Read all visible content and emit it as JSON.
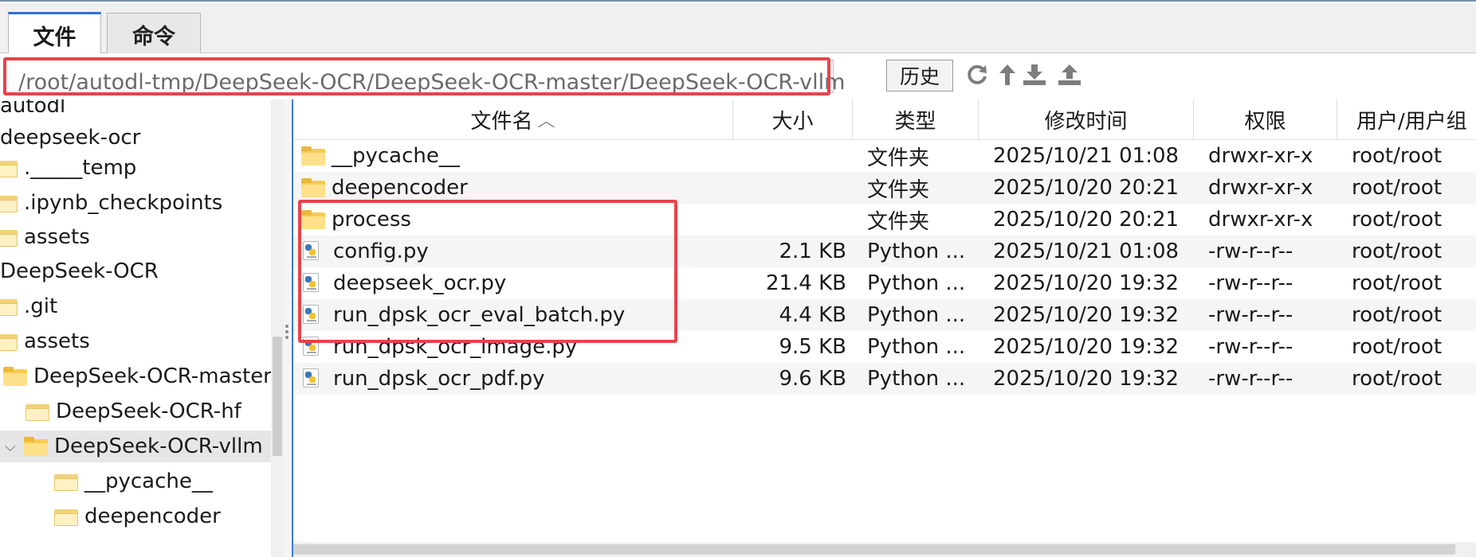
{
  "tabs": [
    {
      "label": "文件",
      "active": true
    },
    {
      "label": "命令",
      "active": false
    }
  ],
  "path_bar": {
    "value": "/root/autodl-tmp/DeepSeek-OCR/DeepSeek-OCR-master/DeepSeek-OCR-vllm",
    "history_label": "历史"
  },
  "toolbar_icons": [
    "refresh-icon",
    "up-directory-icon",
    "download-icon",
    "upload-icon"
  ],
  "tree": [
    {
      "label": "autodl",
      "indent": 0,
      "icon": false
    },
    {
      "label": "deepseek-ocr",
      "indent": 0,
      "icon": false
    },
    {
      "label": "._____temp",
      "indent": 1,
      "icon": true
    },
    {
      "label": ".ipynb_checkpoints",
      "indent": 1,
      "icon": true
    },
    {
      "label": "assets",
      "indent": 1,
      "icon": true
    },
    {
      "label": "DeepSeek-OCR",
      "indent": 0,
      "icon": false
    },
    {
      "label": ".git",
      "indent": 1,
      "icon": true
    },
    {
      "label": "assets",
      "indent": 1,
      "icon": true
    },
    {
      "label": "DeepSeek-OCR-master",
      "indent": 1,
      "icon": true
    },
    {
      "label": "DeepSeek-OCR-hf",
      "indent": 2,
      "icon": true
    },
    {
      "label": "DeepSeek-OCR-vllm",
      "indent": 2,
      "icon": true,
      "selected": true,
      "expanded": true
    },
    {
      "label": "__pycache__",
      "indent": 3,
      "icon": true
    },
    {
      "label": "deepencoder",
      "indent": 3,
      "icon": true
    }
  ],
  "columns": [
    "文件名",
    "大小",
    "类型",
    "修改时间",
    "权限",
    "用户/用户组"
  ],
  "files": [
    {
      "name": "__pycache__",
      "kind": "folder",
      "size": "",
      "type": "文件夹",
      "modified": "2025/10/21 01:08",
      "perm": "drwxr-xr-x",
      "owner": "root/root"
    },
    {
      "name": "deepencoder",
      "kind": "folder",
      "size": "",
      "type": "文件夹",
      "modified": "2025/10/20 20:21",
      "perm": "drwxr-xr-x",
      "owner": "root/root"
    },
    {
      "name": "process",
      "kind": "folder",
      "size": "",
      "type": "文件夹",
      "modified": "2025/10/20 20:21",
      "perm": "drwxr-xr-x",
      "owner": "root/root"
    },
    {
      "name": "config.py",
      "kind": "python",
      "size": "2.1 KB",
      "type": "Python ...",
      "modified": "2025/10/21 01:08",
      "perm": "-rw-r--r--",
      "owner": "root/root"
    },
    {
      "name": "deepseek_ocr.py",
      "kind": "python",
      "size": "21.4 KB",
      "type": "Python ...",
      "modified": "2025/10/20 19:32",
      "perm": "-rw-r--r--",
      "owner": "root/root"
    },
    {
      "name": "run_dpsk_ocr_eval_batch.py",
      "kind": "python",
      "size": "4.4 KB",
      "type": "Python ...",
      "modified": "2025/10/20 19:32",
      "perm": "-rw-r--r--",
      "owner": "root/root"
    },
    {
      "name": "run_dpsk_ocr_image.py",
      "kind": "python",
      "size": "9.5 KB",
      "type": "Python ...",
      "modified": "2025/10/20 19:32",
      "perm": "-rw-r--r--",
      "owner": "root/root"
    },
    {
      "name": "run_dpsk_ocr_pdf.py",
      "kind": "python",
      "size": "9.6 KB",
      "type": "Python ...",
      "modified": "2025/10/20 19:32",
      "perm": "-rw-r--r--",
      "owner": "root/root"
    }
  ],
  "colors": {
    "highlight": "#e8434b",
    "tab_accent": "#2f6fd6",
    "folder": "#f6cc4f"
  }
}
